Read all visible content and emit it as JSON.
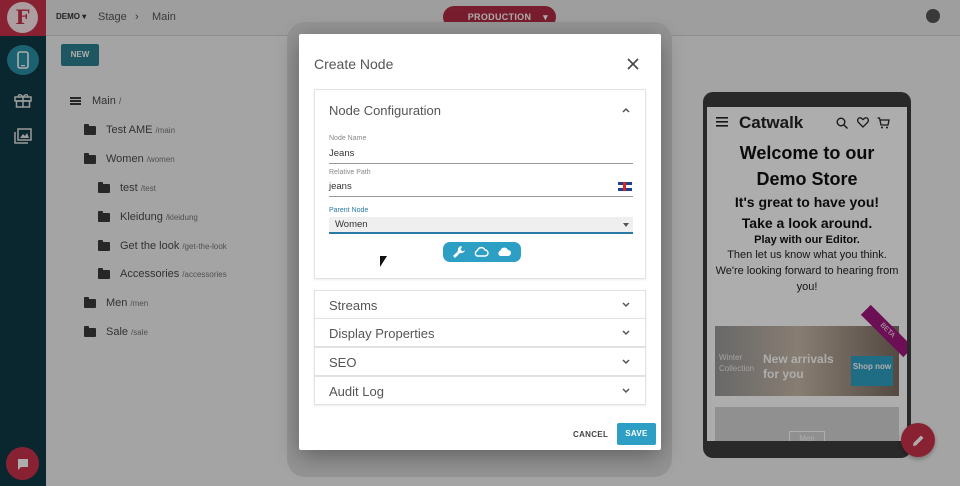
{
  "app": {
    "logo_letter": "F"
  },
  "topbar": {
    "tenant": "DEMO",
    "breadcrumb": [
      "Stage",
      "Main"
    ],
    "environment": "PRODUCTION"
  },
  "toolbar": {
    "new_label": "NEW"
  },
  "tree": {
    "root": {
      "label": "Main",
      "path": "/"
    },
    "items": [
      {
        "label": "Test AME",
        "path": "/main"
      },
      {
        "label": "Women",
        "path": "/women"
      },
      {
        "label": "test",
        "path": "/test"
      },
      {
        "label": "Kleidung",
        "path": "/kleidung"
      },
      {
        "label": "Get the look",
        "path": "/get-the-look"
      },
      {
        "label": "Accessories",
        "path": "/accessories"
      },
      {
        "label": "Men",
        "path": "/men"
      },
      {
        "label": "Sale",
        "path": "/sale"
      }
    ]
  },
  "preview": {
    "store_name": "Catwalk",
    "headline1": "Welcome to our",
    "headline2": "Demo Store",
    "headline3": "It's great to have you!",
    "headline4": "Take a look around.",
    "bold_line": "Play with our Editor.",
    "body": "Then let us know what you think. We're looking forward to hearing from you!",
    "promo": {
      "collection": "Winter Collection",
      "title": "New arrivals for you",
      "cta": "Shop now",
      "ribbon": "BETA"
    },
    "promo2_label": "Men"
  },
  "dialog": {
    "title": "Create Node",
    "config_panel": {
      "title": "Node Configuration",
      "node_name_label": "Node Name",
      "node_name_value": "Jeans",
      "relative_path_label": "Relative Path",
      "relative_path_value": "jeans",
      "parent_node_label": "Parent Node",
      "parent_node_value": "Women"
    },
    "panels": [
      "Streams",
      "Display Properties",
      "SEO",
      "Audit Log"
    ],
    "cancel_label": "CANCEL",
    "save_label": "SAVE"
  },
  "colors": {
    "brand": "#c9334c",
    "rail": "#0f3a46",
    "accent": "#2e9fc4"
  }
}
